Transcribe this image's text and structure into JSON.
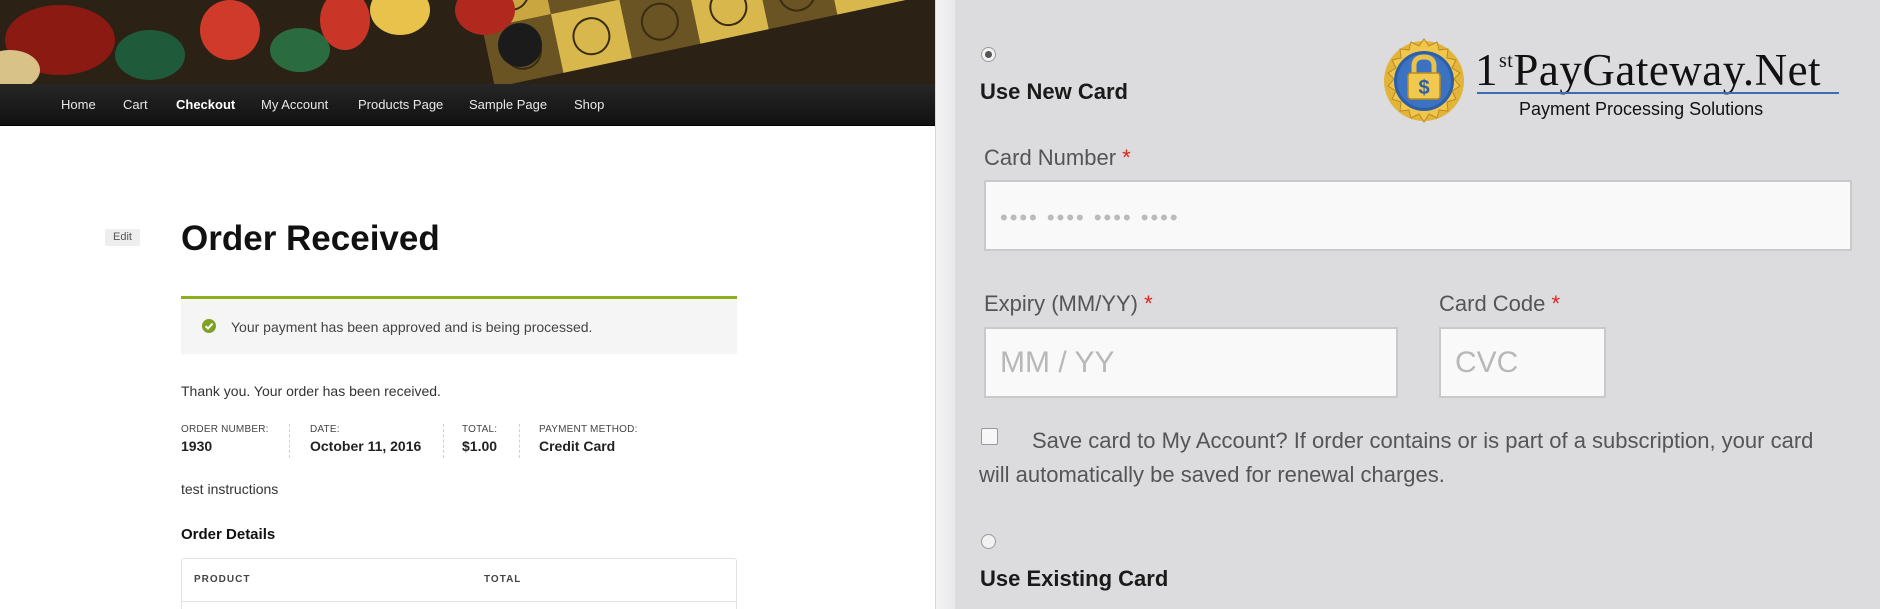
{
  "nav": {
    "items": [
      "Home",
      "Cart",
      "Checkout",
      "My Account",
      "Products Page",
      "Sample Page",
      "Shop"
    ],
    "active": "Checkout"
  },
  "page": {
    "edit_label": "Edit",
    "title": "Order Received",
    "notice": "Your payment has been approved and is being processed.",
    "thanks": "Thank you. Your order has been received.",
    "overview": {
      "order_number_label": "ORDER NUMBER:",
      "order_number": "1930",
      "date_label": "DATE:",
      "date": "October 11, 2016",
      "total_label": "TOTAL:",
      "total": "$1.00",
      "payment_method_label": "PAYMENT METHOD:",
      "payment_method": "Credit Card"
    },
    "instructions": "test instructions",
    "order_details_title": "Order Details",
    "table_headers": {
      "product": "PRODUCT",
      "total": "TOTAL"
    }
  },
  "payment": {
    "use_new_card_label": "Use New Card",
    "card_number_label": "Card Number",
    "card_number_placeholder": "•••• •••• •••• ••••",
    "expiry_label": "Expiry (MM/YY)",
    "expiry_placeholder": "MM / YY",
    "card_code_label": "Card Code",
    "card_code_placeholder": "CVC",
    "required_mark": "*",
    "save_card_text": "Save card to My Account? If order contains or is part of a subscription, your card will automatically be saved for renewal charges.",
    "use_existing_card_label": "Use Existing Card",
    "new_card_selected": true,
    "save_card_checked": false
  },
  "logo": {
    "brand_prefix": "1",
    "brand_sup": "st",
    "brand_rest": "PayGateway.Net",
    "tagline": "Payment Processing Solutions",
    "icon": "padlock-dollar-seal-icon"
  },
  "colors": {
    "accent_green": "#8fae1b",
    "required_red": "#e2231a",
    "logo_gold": "#e2b43a",
    "logo_blue": "#3b6db0"
  }
}
